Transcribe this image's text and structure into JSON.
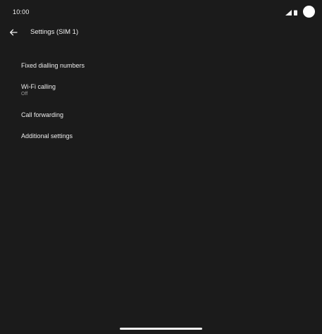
{
  "status_bar": {
    "time": "10:00",
    "icons": [
      "signal-icon",
      "battery-icon",
      "camera-cutout-icon"
    ]
  },
  "app_bar": {
    "back_icon": "arrow-back-icon",
    "title": "Settings (SIM 1)"
  },
  "settings": {
    "items": [
      {
        "label": "Fixed dialling numbers",
        "summary": ""
      },
      {
        "label": "Wi-Fi calling",
        "summary": "Off"
      },
      {
        "label": "Call forwarding",
        "summary": ""
      },
      {
        "label": "Additional settings",
        "summary": ""
      }
    ]
  },
  "colors": {
    "background": "#1b1b1b",
    "text_primary": "#ececec",
    "text_secondary": "#9a9a9a"
  }
}
